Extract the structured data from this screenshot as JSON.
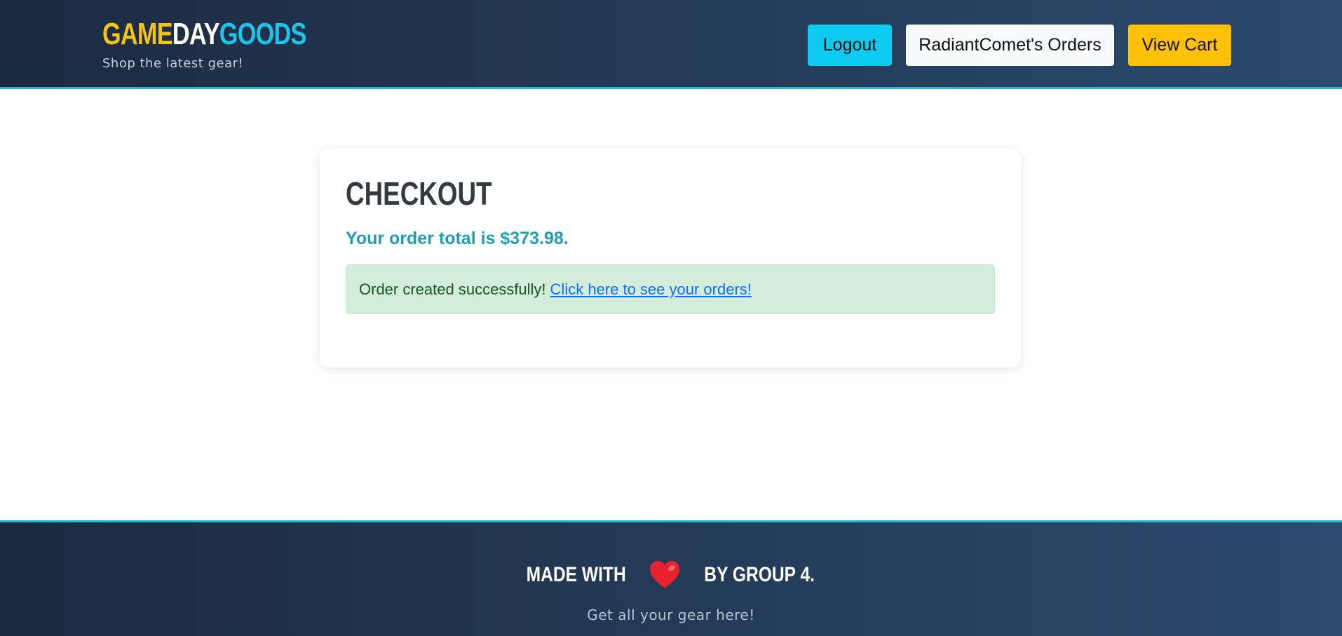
{
  "header": {
    "logo": {
      "part1": "GAME",
      "part2": "DAY",
      "part3": "GOODS"
    },
    "tagline": "Shop the latest gear!",
    "nav": {
      "logout_label": "Logout",
      "orders_label": "RadiantComet's Orders",
      "cart_label": "View Cart"
    }
  },
  "checkout": {
    "title": "CHECKOUT",
    "order_total_text": "Your order total is $373.98.",
    "alert_text": "Order created successfully!",
    "alert_link": "Click here to see your orders!"
  },
  "footer": {
    "made_with": "MADE WITH",
    "heart_icon": "heart-icon",
    "by_group": "BY GROUP 4.",
    "subtitle": "Get all your gear here!"
  },
  "colors": {
    "header_bg_start": "#1c2a3f",
    "header_bg_end": "#2b4a6e",
    "accent_cyan": "#22b8d6",
    "logo_yellow": "#f5c21b",
    "logo_cyan": "#1fc3e8",
    "logout_btn": "#0dcaf0",
    "cart_btn": "#ffc107",
    "total_text": "#1f9db4",
    "alert_bg": "#d4edda",
    "link": "#0d6efd"
  }
}
